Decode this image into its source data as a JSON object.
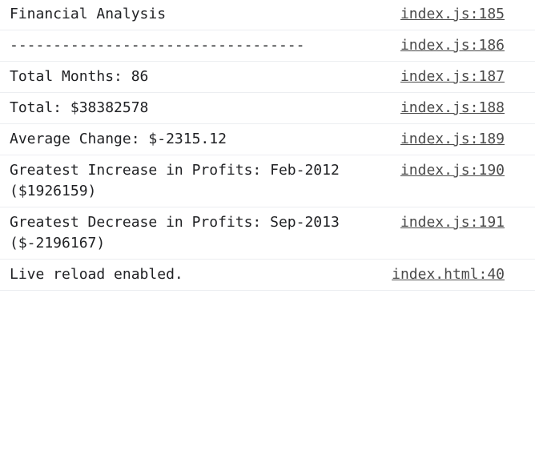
{
  "console": {
    "messages": [
      {
        "text": "Financial Analysis",
        "source": "index.js:185"
      },
      {
        "text": "----------------------------------",
        "source": "index.js:186"
      },
      {
        "text": "Total Months: 86",
        "source": "index.js:187"
      },
      {
        "text": "Total: $38382578",
        "source": "index.js:188"
      },
      {
        "text": "Average Change: $-2315.12",
        "source": "index.js:189"
      },
      {
        "text": "Greatest Increase in Profits: Feb-2012 ($1926159)",
        "source": "index.js:190"
      },
      {
        "text": "Greatest Decrease in Profits: Sep-2013 ($-2196167)",
        "source": "index.js:191"
      },
      {
        "text": "Live reload enabled.",
        "source": "index.html:40"
      }
    ]
  }
}
